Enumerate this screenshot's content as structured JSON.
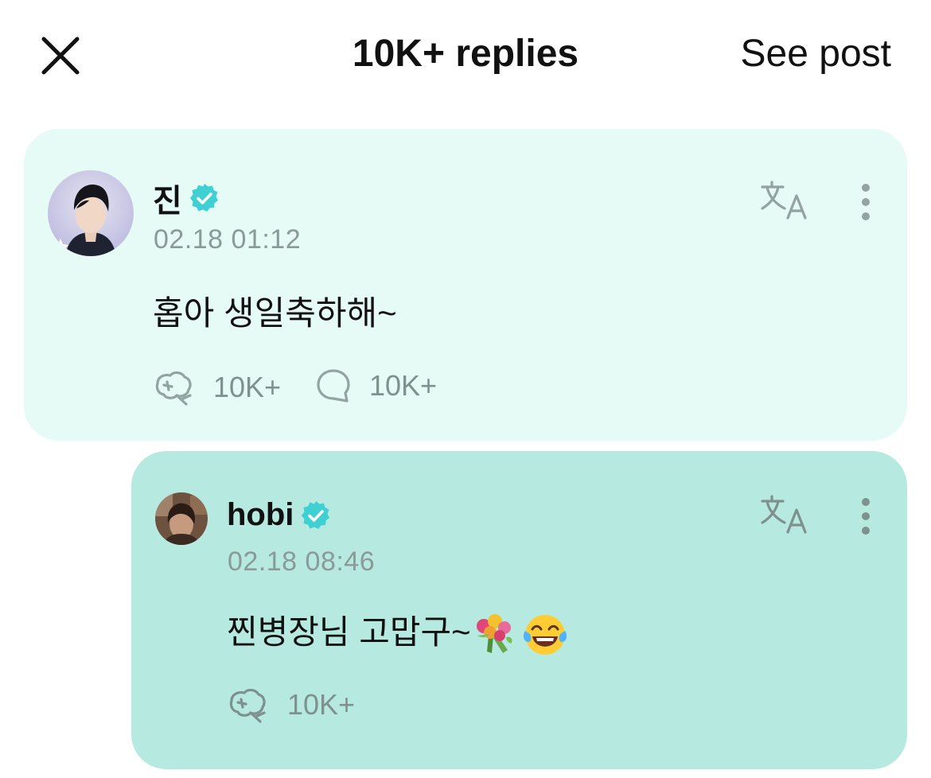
{
  "header": {
    "title": "10K+ replies",
    "see_post": "See post"
  },
  "colors": {
    "main_card_bg": "#e6faf6",
    "reply_card_bg": "#b6eae1",
    "verified": "#3fd0d4",
    "muted": "#7f918f"
  },
  "post": {
    "author": "진",
    "timestamp": "02.18 01:12",
    "text": "홉아 생일축하해~",
    "cheer_count": "10K+",
    "comment_count": "10K+"
  },
  "reply": {
    "author": "hobi",
    "timestamp": "02.18 08:46",
    "text": "찐병장님 고맙구~",
    "emojis": [
      "bouquet-emoji",
      "tears-of-joy-emoji"
    ],
    "cheer_count": "10K+"
  },
  "icons": [
    "close-icon",
    "verified-badge-icon",
    "translate-icon",
    "more-icon",
    "cheer-icon",
    "comment-icon"
  ]
}
